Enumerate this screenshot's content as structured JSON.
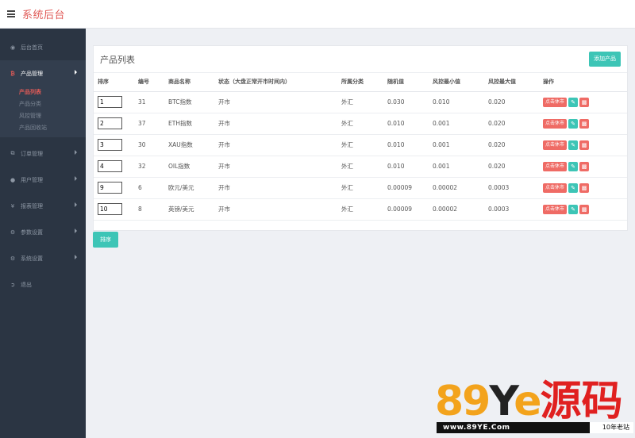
{
  "app": {
    "title": "系统后台"
  },
  "sidebar": {
    "items": [
      {
        "label": "后台首页",
        "icon": "dashboard-icon"
      },
      {
        "label": "产品管理",
        "icon": "bitcoin-icon"
      },
      {
        "label": "订单管理",
        "icon": "copy-icon"
      },
      {
        "label": "用户管理",
        "icon": "user-icon"
      },
      {
        "label": "报表管理",
        "icon": "yen-icon"
      },
      {
        "label": "参数设置",
        "icon": "gear-icon"
      },
      {
        "label": "系统设置",
        "icon": "gears-icon"
      },
      {
        "label": "退出",
        "icon": "sign-out-icon"
      }
    ],
    "submenu": [
      {
        "label": "产品列表"
      },
      {
        "label": "产品分类"
      },
      {
        "label": "风控管理"
      },
      {
        "label": "产品回收站"
      }
    ]
  },
  "panel": {
    "title": "产品列表",
    "add_label": "添加产品"
  },
  "table": {
    "headers": [
      "排序",
      "编号",
      "商品名称",
      "状态（大盘正常开市时间内）",
      "所属分类",
      "随机值",
      "风控最小值",
      "风控最大值",
      "操作"
    ],
    "rows": [
      {
        "sort": "1",
        "id": "31",
        "name": "BTC指数",
        "status": "开市",
        "category": "外汇",
        "random": "0.030",
        "min": "0.010",
        "max": "0.020",
        "action": "点击休市"
      },
      {
        "sort": "2",
        "id": "37",
        "name": "ETH指数",
        "status": "开市",
        "category": "外汇",
        "random": "0.010",
        "min": "0.001",
        "max": "0.020",
        "action": "点击休市"
      },
      {
        "sort": "3",
        "id": "30",
        "name": "XAU指数",
        "status": "开市",
        "category": "外汇",
        "random": "0.010",
        "min": "0.001",
        "max": "0.020",
        "action": "点击休市"
      },
      {
        "sort": "4",
        "id": "32",
        "name": "OIL指数",
        "status": "开市",
        "category": "外汇",
        "random": "0.010",
        "min": "0.001",
        "max": "0.020",
        "action": "点击休市"
      },
      {
        "sort": "9",
        "id": "6",
        "name": "欧元/美元",
        "status": "开市",
        "category": "外汇",
        "random": "0.00009",
        "min": "0.00002",
        "max": "0.0003",
        "action": "点击休市"
      },
      {
        "sort": "10",
        "id": "8",
        "name": "英镑/美元",
        "status": "开市",
        "category": "外汇",
        "random": "0.00009",
        "min": "0.00002",
        "max": "0.0003",
        "action": "点击休市"
      }
    ]
  },
  "sort_button": "排序",
  "watermark": {
    "logo_digits": "89",
    "logo_y": "Y",
    "logo_e": "e",
    "logo_cn": "源码",
    "url": "www.89YE.Com",
    "tag": "10年老站"
  },
  "colors": {
    "brand": "#e05a57",
    "sidebar_bg": "#2b3543",
    "teal": "#3dc5b6",
    "red": "#ef6b65"
  }
}
